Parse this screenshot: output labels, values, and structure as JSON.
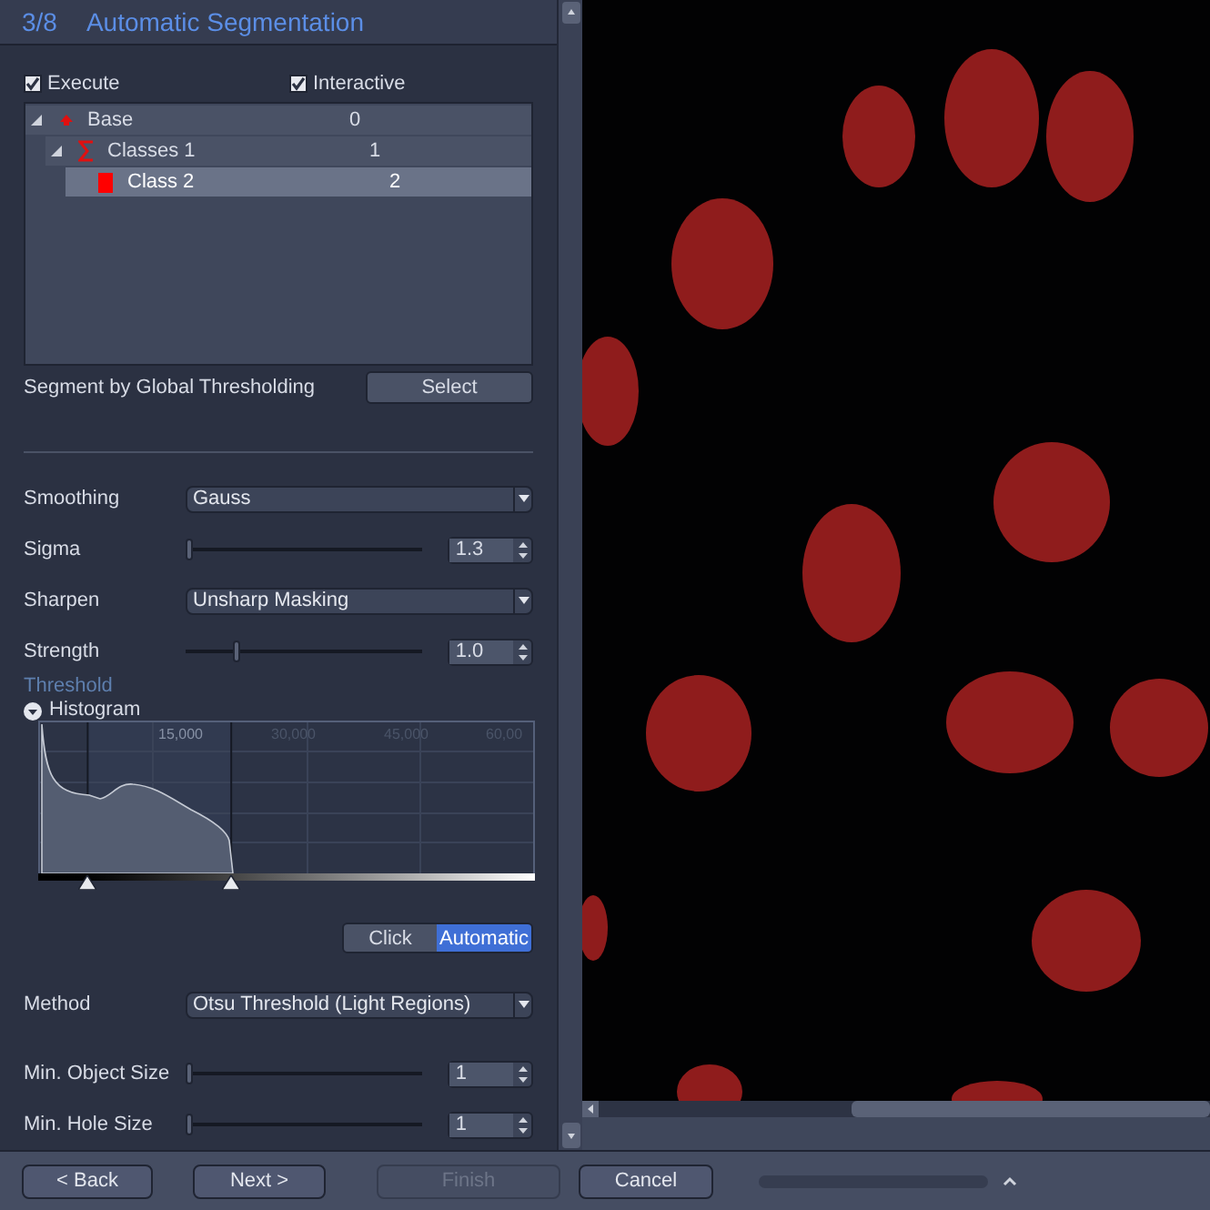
{
  "header": {
    "step": "3/8",
    "title": "Automatic Segmentation"
  },
  "options": [
    {
      "label": "Execute",
      "checked": true
    },
    {
      "label": "Interactive",
      "checked": true
    }
  ],
  "tree": [
    {
      "label": "Base",
      "value": "0",
      "kind": "base",
      "expanded": true,
      "selected": false,
      "children": [
        {
          "label": "Classes 1",
          "value": "1",
          "kind": "classes",
          "expanded": true,
          "selected": false,
          "children": [
            {
              "label": "Class 2",
              "value": "2",
              "kind": "class",
              "selected": true,
              "color": "#ff0000"
            }
          ]
        }
      ]
    }
  ],
  "segment": {
    "label": "Segment by Global Thresholding",
    "button": "Select"
  },
  "settings": [
    {
      "kind": "dropdown",
      "label": "Smoothing",
      "value": "Gauss"
    },
    {
      "kind": "slider",
      "label": "Sigma",
      "level": 0.0,
      "value": "1.3"
    },
    {
      "kind": "dropdown",
      "label": "Sharpen",
      "value": "Unsharp Masking"
    },
    {
      "kind": "slider",
      "label": "Strength",
      "level": 0.2,
      "value": "1.0"
    }
  ],
  "threshold": {
    "heading": "Threshold",
    "histogram_label": "Histogram",
    "expanded": true,
    "axis_labels": [
      "15,000",
      "30,000",
      "45,000",
      "60,00"
    ],
    "thresholds": [
      {
        "level": 0.1
      },
      {
        "level": 0.39
      }
    ],
    "modes": [
      {
        "label": "Click",
        "selected": false
      },
      {
        "label": "Automatic",
        "selected": true
      }
    ]
  },
  "settings2": [
    {
      "kind": "dropdown",
      "label": "Method",
      "value": "Otsu Threshold (Light Regions)"
    },
    {
      "kind": "slider",
      "label": "Min. Object Size",
      "level": 0.0,
      "value": "1"
    },
    {
      "kind": "slider",
      "label": "Min. Hole Size",
      "level": 0.0,
      "value": "1"
    }
  ],
  "footer": [
    {
      "label": "< Back",
      "disabled": false
    },
    {
      "label": "Next >",
      "disabled": false
    },
    {
      "label": "Finish",
      "disabled": true
    },
    {
      "label": "Cancel",
      "disabled": false
    }
  ]
}
